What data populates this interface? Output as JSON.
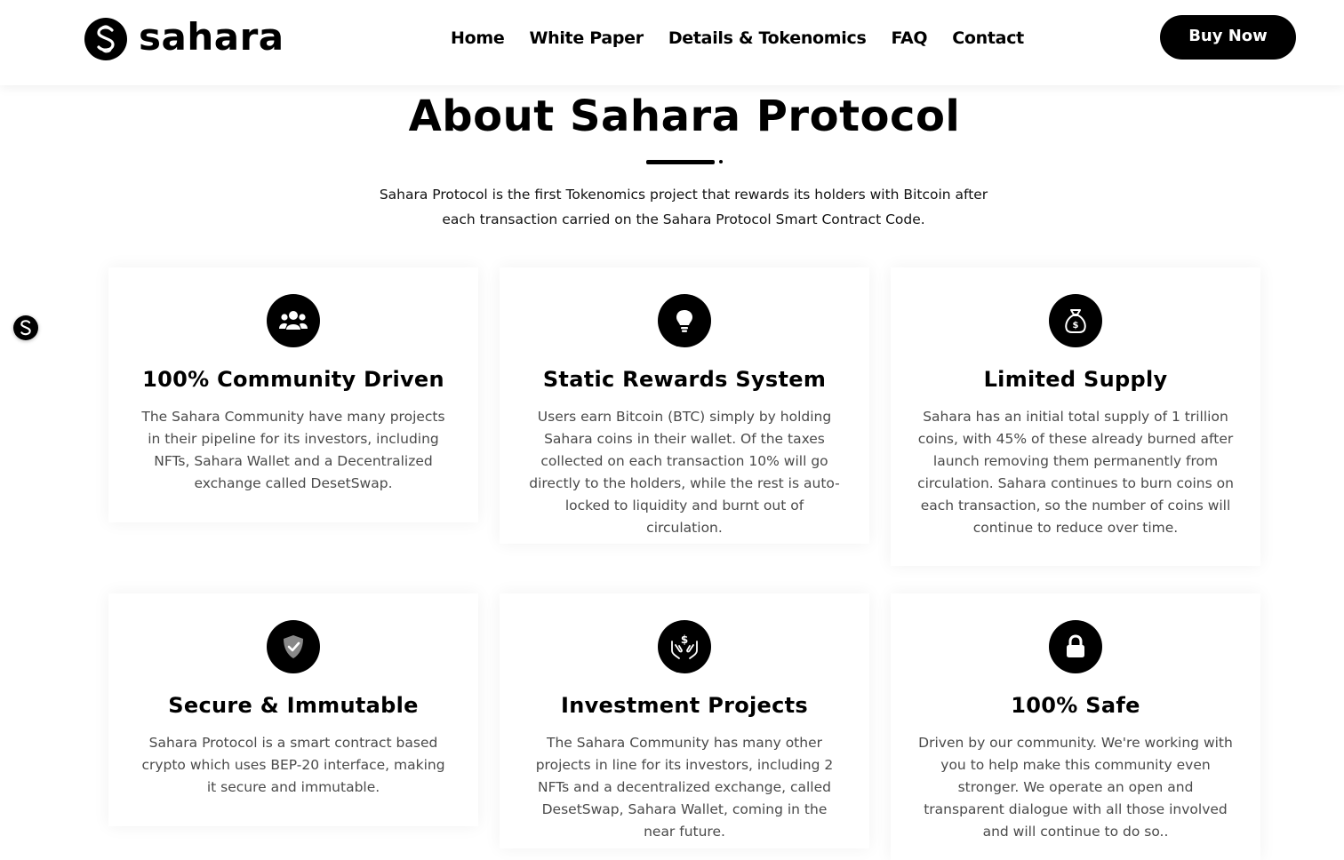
{
  "header": {
    "brand": "sahara",
    "nav": [
      "Home",
      "White Paper",
      "Details & Tokenomics",
      "FAQ",
      "Contact"
    ],
    "buy_label": "Buy Now"
  },
  "about": {
    "title": "About Sahara Protocol",
    "description": "Sahara Protocol is the first Tokenomics project that rewards its holders with Bitcoin after each transaction carried on the Sahara Protocol Smart Contract Code."
  },
  "features": [
    {
      "icon": "users-icon",
      "title": "100% Community Driven",
      "text": "The Sahara Community have many projects in their pipeline for its investors, including NFTs, Sahara Wallet and a Decentralized exchange called DesetSwap."
    },
    {
      "icon": "lightbulb-icon",
      "title": "Static Rewards System",
      "text": "Users earn Bitcoin (BTC) simply by holding Sahara coins in their wallet. Of the taxes collected on each transaction 10% will go directly to the holders, while the rest is auto-locked to liquidity and burnt out of circulation."
    },
    {
      "icon": "money-bag-icon",
      "title": "Limited Supply",
      "text": "Sahara has an initial total supply of 1 trillion coins, with 45% of these already burned after launch removing them permanently from circulation. Sahara continues to burn coins on each transaction, so the number of coins will continue to reduce over time."
    },
    {
      "icon": "shield-check-icon",
      "title": "Secure & Immutable",
      "text": "Sahara Protocol is a smart contract based crypto which uses BEP-20 interface, making it secure and immutable."
    },
    {
      "icon": "hands-dollar-icon",
      "title": "Investment Projects",
      "text": "The Sahara Community has many other projects in line for its investors, including 2 NFTs and a decentralized exchange, called DesetSwap, Sahara Wallet, coming in the near future."
    },
    {
      "icon": "lock-icon",
      "title": "100% Safe",
      "text": "Driven by our community. We're working with you to help make this community even stronger. We operate an open and transparent dialogue with all those involved and will continue to do so.."
    }
  ]
}
